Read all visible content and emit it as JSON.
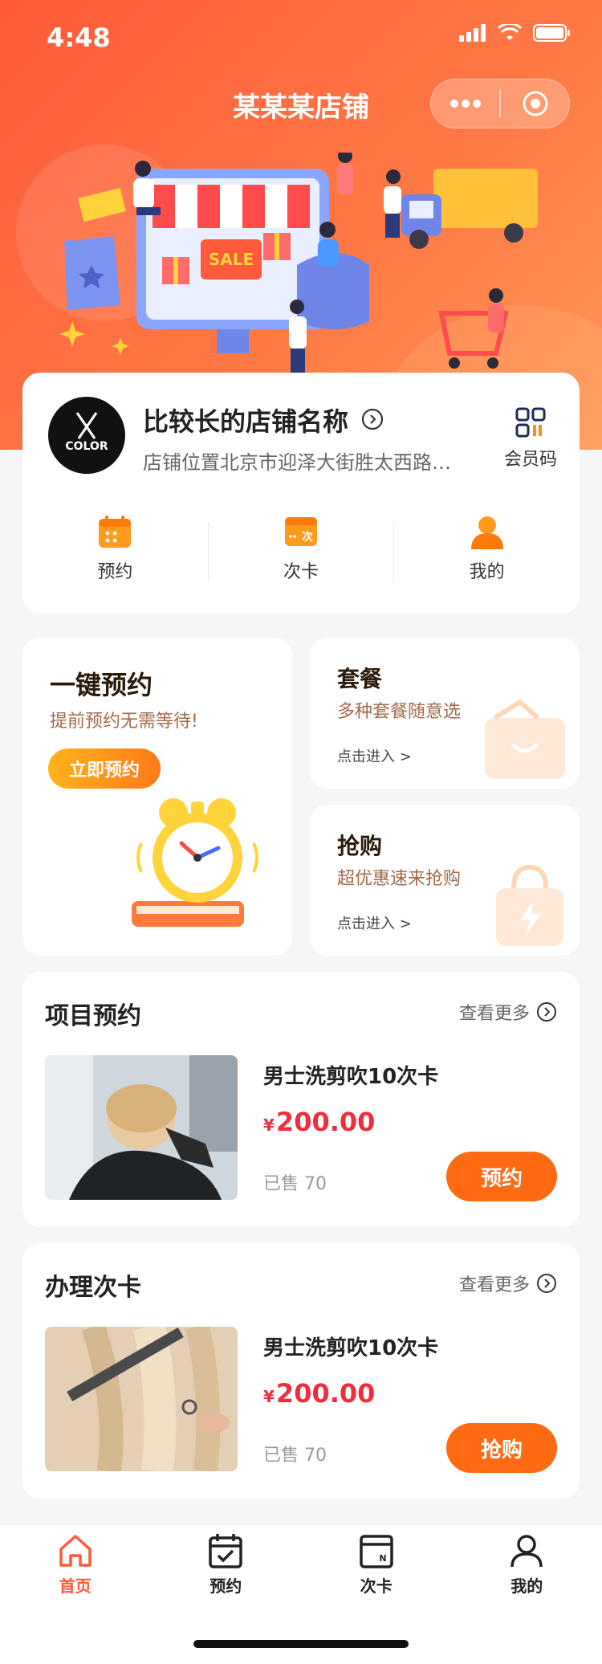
{
  "status": {
    "time": "4:48"
  },
  "header": {
    "title": "某某某店铺"
  },
  "store": {
    "name": "比较长的店铺名称",
    "address": "店铺位置北京市迎泽大街胜太西路…",
    "logo_text": "COLOR",
    "member_label": "会员码"
  },
  "quick_actions": [
    {
      "label": "预约",
      "icon": "calendar-icon"
    },
    {
      "label": "次卡",
      "icon": "card-icon"
    },
    {
      "label": "我的",
      "icon": "user-icon"
    }
  ],
  "promos": {
    "booking": {
      "title": "一键预约",
      "subtitle": "提前预约无需等待!",
      "cta": "立即预约"
    },
    "package": {
      "title": "套餐",
      "subtitle": "多种套餐随意选",
      "link": "点击进入 >"
    },
    "flash": {
      "title": "抢购",
      "subtitle": "超优惠速来抢购",
      "link": "点击进入 >"
    }
  },
  "sections": [
    {
      "title": "项目预约",
      "more": "查看更多",
      "product": {
        "name": "男士洗剪吹10次卡",
        "currency": "¥",
        "price": "200.00",
        "sold": "已售 70",
        "button": "预约"
      }
    },
    {
      "title": "办理次卡",
      "more": "查看更多",
      "product": {
        "name": "男士洗剪吹10次卡",
        "currency": "¥",
        "price": "200.00",
        "sold": "已售 70",
        "button": "抢购"
      }
    }
  ],
  "tabbar": [
    {
      "label": "首页",
      "icon": "home-icon",
      "active": true
    },
    {
      "label": "预约",
      "icon": "calendar-check-icon",
      "active": false
    },
    {
      "label": "次卡",
      "icon": "card-icon",
      "active": false
    },
    {
      "label": "我的",
      "icon": "user-icon",
      "active": false
    }
  ],
  "colors": {
    "primary": "#ff6a13",
    "price": "#ee2e3c",
    "header_gradient_start": "#ff5a3a",
    "header_gradient_end": "#ff9a5a"
  }
}
